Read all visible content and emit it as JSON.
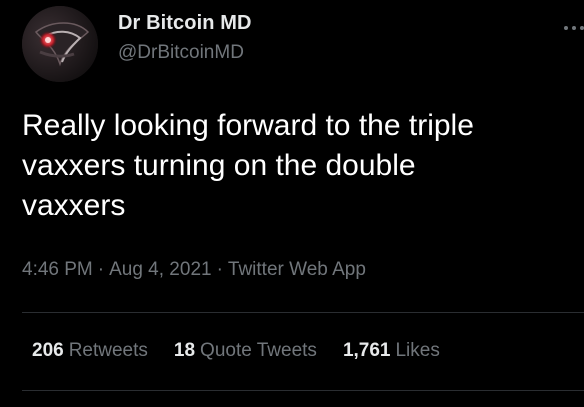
{
  "author": {
    "display_name": "Dr Bitcoin MD",
    "handle": "@DrBitcoinMD",
    "avatar_icon": "avatar-image"
  },
  "tweet": {
    "lines": [
      "Really looking forward to the triple",
      "vaxxers turning on the double",
      "vaxxers"
    ]
  },
  "meta": {
    "time": "4:46 PM",
    "separator": "·",
    "date": "Aug 4, 2021",
    "source": "Twitter Web App"
  },
  "stats": [
    {
      "count": "206",
      "label": "Retweets"
    },
    {
      "count": "18",
      "label": "Quote Tweets"
    },
    {
      "count": "1,761",
      "label": "Likes"
    }
  ],
  "icons": {
    "more": "more-options-icon"
  },
  "colors": {
    "background": "#000000",
    "primary_text": "#ffffff",
    "secondary_text": "#71767b",
    "divider": "#2a2d31"
  }
}
